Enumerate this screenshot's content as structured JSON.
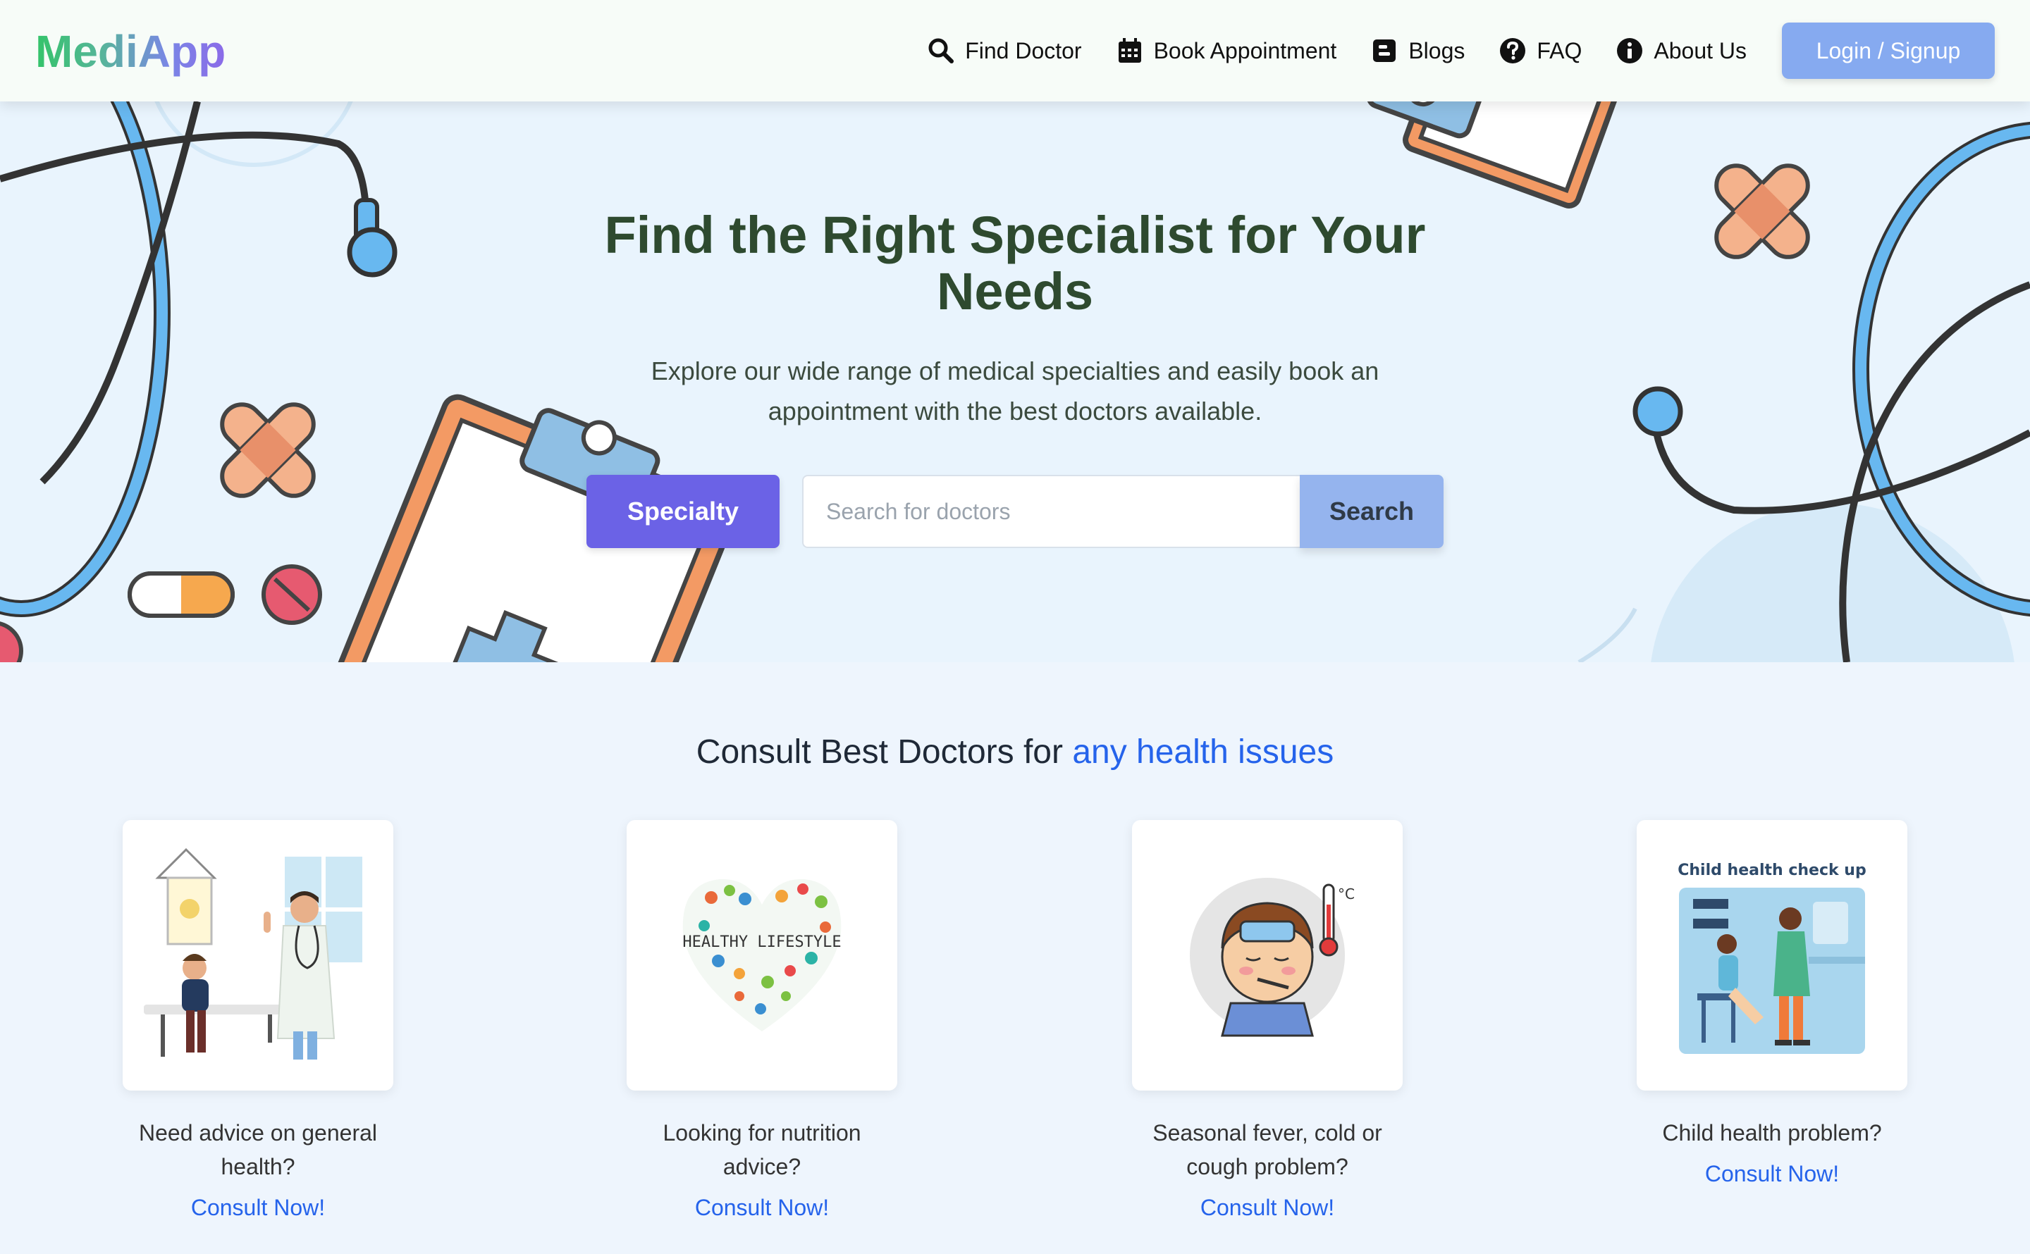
{
  "brand": {
    "logo_text": "MediApp"
  },
  "nav": {
    "items": [
      {
        "label": "Find Doctor",
        "icon": "search-icon"
      },
      {
        "label": "Book Appointment",
        "icon": "calendar-icon"
      },
      {
        "label": "Blogs",
        "icon": "blog-icon"
      },
      {
        "label": "FAQ",
        "icon": "question-circle-icon"
      },
      {
        "label": "About Us",
        "icon": "info-circle-icon"
      }
    ],
    "login_label": "Login / Signup"
  },
  "hero": {
    "title_line1": "Find the Right Specialist for Your",
    "title_line2": "Needs",
    "subtitle_line1": "Explore our wide range of medical specialties and easily book an",
    "subtitle_line2": "appointment with the best doctors available.",
    "specialty_label": "Specialty",
    "search_placeholder": "Search for doctors",
    "search_value": "",
    "search_label": "Search"
  },
  "consult": {
    "title_prefix": "Consult Best Doctors for ",
    "title_highlight": "any health issues",
    "cards": [
      {
        "line1": "Need advice on general",
        "line2": "health?",
        "link": "Consult Now!"
      },
      {
        "line1": "Looking for nutrition",
        "line2": "advice?",
        "link": "Consult Now!",
        "image_text": "HEALTHY LIFESTYLE"
      },
      {
        "line1": "Seasonal fever, cold or",
        "line2": "cough problem?",
        "link": "Consult Now!",
        "image_text": "°C"
      },
      {
        "line1": "Child health problem?",
        "line2": "",
        "link": "Consult Now!",
        "image_text": "Child health check up"
      }
    ]
  },
  "colors": {
    "accent_purple": "#6b62e6",
    "accent_blue": "#2563eb",
    "login_blue": "#86aaf0",
    "search_blue": "#95b4ee",
    "hero_title": "#2e4a2f"
  }
}
